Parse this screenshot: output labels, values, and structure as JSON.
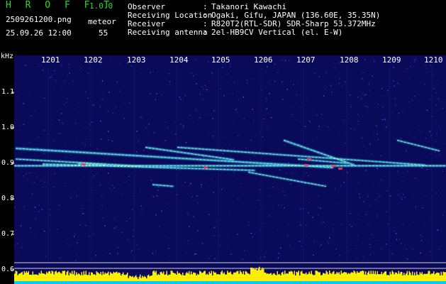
{
  "header": {
    "title": "H R O F F T",
    "version": "1.0.0",
    "filename": "2509261200.png",
    "timestamp": "25.09.26 12:00",
    "meteor_label": "meteor",
    "meteor_count": "55",
    "info": [
      {
        "label": "Observer",
        "value": "Takanori Kawachi"
      },
      {
        "label": "Receiving Location",
        "value": "Ogaki, Gifu, JAPAN (136.60E, 35.35N)"
      },
      {
        "label": "Receiver",
        "value": "R820T2(RTL-SDR) SDR-Sharp 53.372MHz"
      },
      {
        "label": "Receiving antenna",
        "value": "2el-HB9CV Vertical (el. E-W)"
      }
    ]
  },
  "chart_data": {
    "type": "heatmap",
    "x_unit": "minute",
    "x_ticks": [
      "1201",
      "1202",
      "1203",
      "1204",
      "1205",
      "1206",
      "1207",
      "1208",
      "1209",
      "1210"
    ],
    "y_unit": "kHz",
    "y_ticks": [
      "1.1",
      "1.0",
      "0.9",
      "0.8",
      "0.7",
      "0.6"
    ],
    "ylim": [
      0.58,
      1.2
    ],
    "colors": {
      "background": "#0a0a5a",
      "trace_core": "#ffff66",
      "trace_edge": "#33ccff",
      "trace_hot": "#ff3355",
      "power_bars": "#ffee00",
      "power_base": "#00ccff",
      "header_green": "#22dd22"
    }
  }
}
